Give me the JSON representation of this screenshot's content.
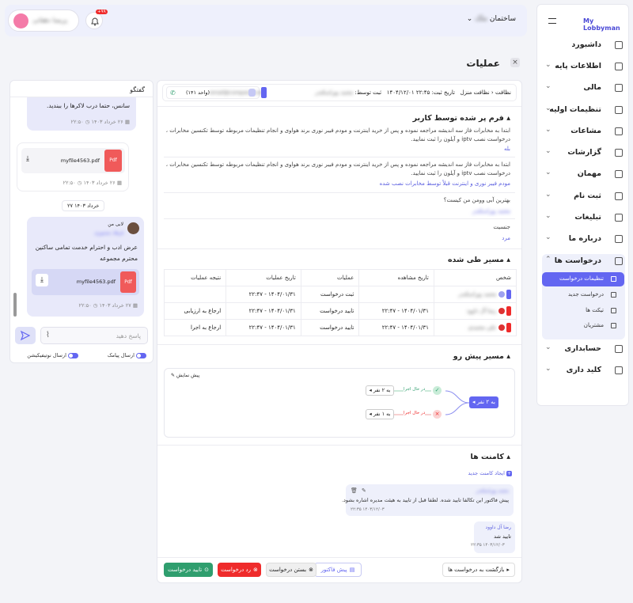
{
  "sidebar": {
    "brand": "My Lobbyman",
    "items": [
      {
        "label": "داشبورد"
      },
      {
        "label": "اطلاعات پایه"
      },
      {
        "label": "مالی"
      },
      {
        "label": "تنظیمات اولیه"
      },
      {
        "label": "مشاعات"
      },
      {
        "label": "گزارشات"
      },
      {
        "label": "مهمان"
      },
      {
        "label": "ثبت نام"
      },
      {
        "label": "تبلیغات"
      },
      {
        "label": "درباره ما"
      },
      {
        "label": "درخواست ها"
      },
      {
        "label": "حسابداری"
      },
      {
        "label": "کلید داری"
      }
    ],
    "sub_items": [
      {
        "label": "تنظیمات درخواست"
      },
      {
        "label": "درخواست جدید"
      },
      {
        "label": "تیکت ها"
      },
      {
        "label": "مشتریان"
      }
    ]
  },
  "header": {
    "building_label": "ساختمان",
    "building_value": "ملک",
    "notif_badge": "+۹۹",
    "user_name": "پریسا دهقانی"
  },
  "page": {
    "title": "عملیات"
  },
  "request_bar": {
    "type": "نظافت",
    "type_detail": "نظافت منزل",
    "date_label": "تاریخ ثبت:",
    "date_value": "۲۲:۴۵ ۱۴۰۴/۱۲/۰۱",
    "by_label": "ثبت توسط:",
    "by_value": "محمد پوراسکندر",
    "unit_name": "(واحد ۱۴۱)",
    "unit_email": "email@company.com"
  },
  "form": {
    "title": "فرم پر شده توسط کاربر",
    "q1": "ابتدا به مخابرات فاز سه اندیشه مراجعه نموده و پس از خرید اینترنت و مودم فیبر نوری برند هواوی و انجام تنظیمات مربوطه توسط تکنسین مخابرات ، درخواست نصب iptv و آیلون را ثبت نمایید.",
    "a1": "بله",
    "q2": "ابتدا به مخابرات فاز سه اندیشه مراجعه نموده و پس از خرید اینترنت و مودم فیبر نوری برند هواوی و انجام تنظیمات مربوطه توسط تکنسین مخابرات ، درخواست نصب iptv و آیلون را ثبت نمایید.",
    "a2": "مودم فیبر نوری و اینترنت قبلاً توسط مخابرات نصب شده",
    "q3": "بهترین آبی وومن من کیست؟",
    "a3": "محمد پوراسکندر",
    "q4": "جنسیت",
    "a4": "مرد"
  },
  "path": {
    "title": "مسیر طی شده",
    "headers": [
      "شخص",
      "تاریخ مشاهده",
      "عملیات",
      "تاریخ عملیات",
      "نتیجه عملیات"
    ],
    "rows": [
      {
        "person": "محمد پوراسکندر",
        "seen": "",
        "op": "ثبت درخواست",
        "op_date": "۱۴۰۴/۰۱/۳۱ - ۲۲:۴۷",
        "result": ""
      },
      {
        "person": "رضا آل داوود",
        "seen": "۱۴۰۴/۰۱/۳۱ - ۲۲:۴۷",
        "op": "تایید درخواست",
        "op_date": "۱۴۰۴/۰۱/۳۱ - ۲۲:۴۷",
        "result": "ارجاع به ارزیابی"
      },
      {
        "person": "علی محمدی",
        "seen": "۱۴۰۴/۰۱/۳۱ - ۲۲:۴۷",
        "op": "تایید درخواست",
        "op_date": "۱۴۰۴/۰۱/۳۱ - ۲۲:۴۷",
        "result": "ارجاع به اجرا"
      }
    ]
  },
  "ahead": {
    "title": "مسیر پیش رو",
    "preview": "پیش نمایش",
    "root": "به ۲ نفر",
    "top_status": "در حال اجرا",
    "top_target": "به ۲ نفر",
    "bottom_status": "در حال اجرا",
    "bottom_target": "به ۱ نفر"
  },
  "comments": {
    "title": "کامنت ها",
    "new_label": "ایجاد کامنت جدید",
    "items": [
      {
        "author": "محمد پوراسکندر",
        "text": "پیش فاکتور این تکالفا تایید شده. لطفا قبل از تایید به هیئت مدیره اشاره بشود.",
        "time": "۲۲:۳۵ ۱۴۰۳/۱۲/۰۳"
      },
      {
        "author": "رضا آل داوود",
        "text": "تایید شد",
        "time": "۲۲:۳۵ ۱۴۰۳/۱۲/۰۳"
      }
    ]
  },
  "actions": {
    "back": "بازگشت به درخواست ها",
    "invoice": "پیش فاکتور",
    "close": "بستن درخواست",
    "reject": "رد درخواست",
    "approve": "تایید درخواست"
  },
  "chat": {
    "title": "گفتگو",
    "msg1": "سانس، حتما درب لاکرها را ببندید.",
    "msg1_time": "۲۲:۵۰",
    "msg1_date": "۲۶ خرداد ۱۴۰۳",
    "file1": "myfile4563.pdf",
    "file_badge": "Pdf",
    "file1_time": "۲۲:۵۰",
    "file1_date": "۲۶ خرداد ۱۴۰۳",
    "day_sep": "۲۷ خرداد ۱۴۰۳",
    "sender": "لابی من",
    "sender_sub": "فرهاد منصوری",
    "msg2_l1": "عرض ادب و احترام خدمت تمامی ساکنین",
    "msg2_l2": "محترم مجموعه",
    "file2": "myfile4563.pdf",
    "file2_time": "۲۲:۵۰",
    "file2_date": "۲۷ خرداد ۱۴۰۳",
    "input_placeholder": "پاسخ دهید",
    "sms_label": "ارسال پیامک",
    "notif_label": "ارسال نوتیفیکیشن"
  },
  "colors": {
    "accent": "#6366f1",
    "approve": "#2f9e6e",
    "reject": "#ef2b2b"
  }
}
